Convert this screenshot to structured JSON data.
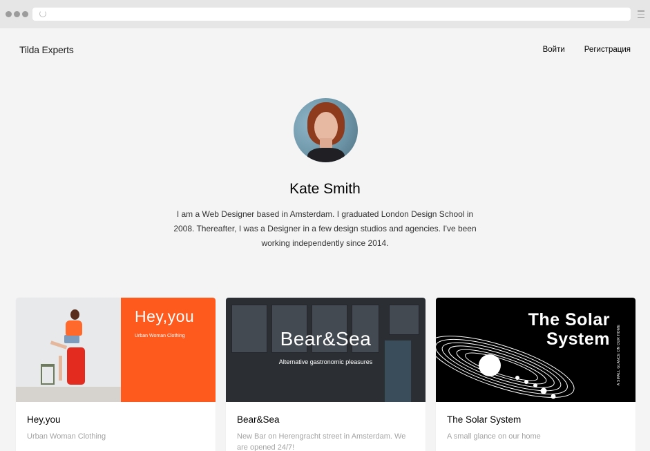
{
  "site": {
    "logo": "Tilda Experts",
    "nav": {
      "login": "Войти",
      "register": "Регистрация"
    }
  },
  "profile": {
    "name": "Kate Smith",
    "bio": "I am a Web Designer based in Amsterdam. I graduated London Design School in 2008. Thereafter, I was a Designer in a few design studios and agencies. I've been working independently since 2014."
  },
  "cards": [
    {
      "title": "Hey,you",
      "description": "Urban Woman Clothing",
      "thumb": {
        "headline": "Hey,you",
        "subline": "Urban Woman Clothing",
        "accent": "#ff5a1d"
      }
    },
    {
      "title": "Bear&Sea",
      "description": "New Bar on Herengracht street in Amsterdam. We are opened 24/7!",
      "thumb": {
        "headline": "Bear&Sea",
        "subline": "Alternative gastronomic pleasures"
      }
    },
    {
      "title": "The Solar System",
      "description": "A small glance on our home",
      "thumb": {
        "headline_line1": "The Solar",
        "headline_line2": "System",
        "side_text": "A SMALL GLANCE ON OUR HOME"
      }
    }
  ]
}
